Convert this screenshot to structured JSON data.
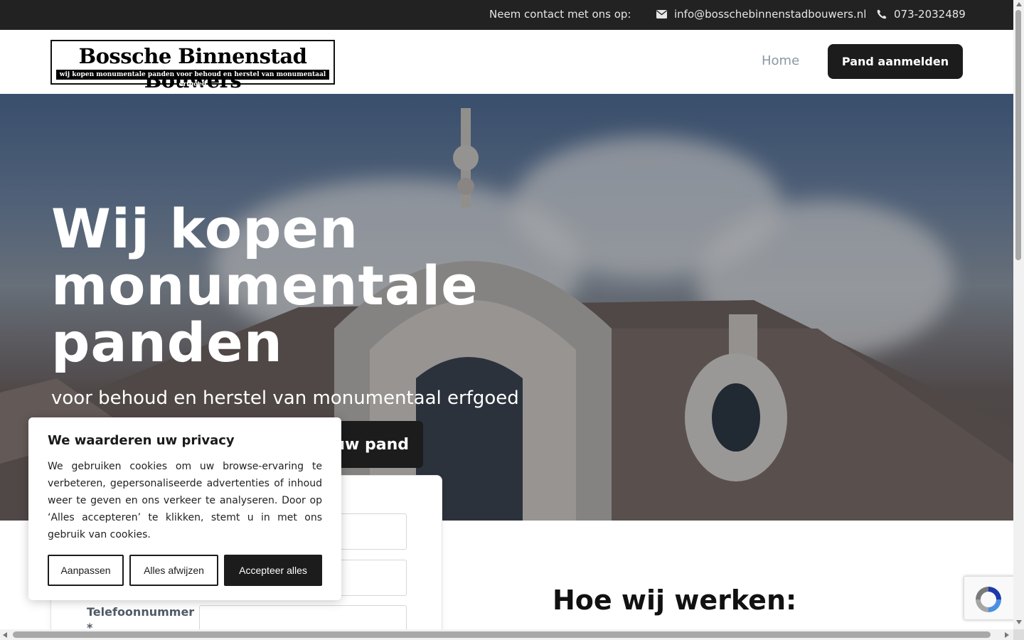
{
  "topbar": {
    "contact_label": "Neem contact met ons op:",
    "email": "info@bosschebinnenstadbouwers.nl",
    "phone": "073-2032489",
    "email_icon": "envelope-icon",
    "phone_icon": "phone-icon"
  },
  "header": {
    "logo_title": "Bossche Binnenstad Bouwers",
    "logo_tagline": "wij kopen monumentale panden voor behoud en herstel van monumentaal erfgoed",
    "nav_home": "Home",
    "cta_label": "Pand aanmelden"
  },
  "hero": {
    "title": "Wij kopen monumentale panden",
    "subtitle": "voor behoud en herstel van monumentaal erfgoed",
    "button_label": "uw pand"
  },
  "form": {
    "phone_label": "Telefoonnummer *"
  },
  "section": {
    "how_title": "Hoe wij werken:"
  },
  "cookie": {
    "title": "We waarderen uw privacy",
    "text": "We gebruiken cookies om uw browse-ervaring te verbeteren, gepersonaliseerde advertenties of inhoud weer te geven en ons verkeer te analyseren. Door op ‘Alles accepteren’ te klikken, stemt u in met ons gebruik van cookies.",
    "customize_label": "Aanpassen",
    "reject_label": "Alles afwijzen",
    "accept_label": "Accepteer alles"
  },
  "colors": {
    "dark": "#1c1c1c",
    "topbar_bg": "#222222",
    "nav_link": "#8b97a3"
  }
}
